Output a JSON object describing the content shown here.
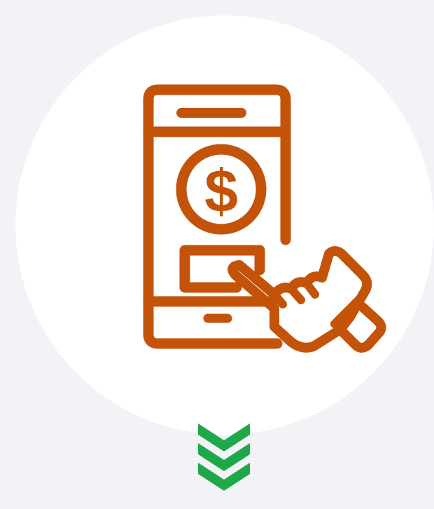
{
  "illustration": {
    "icon": "mobile-payment-icon",
    "currency_symbol": "$",
    "primary_color": "#c4530a",
    "background_circle_color": "#ffffff"
  },
  "scroll_indicator": {
    "icon": "chevron-triple-down-icon",
    "color": "#1fa84a"
  },
  "page": {
    "background_color": "#f2f3f7"
  }
}
